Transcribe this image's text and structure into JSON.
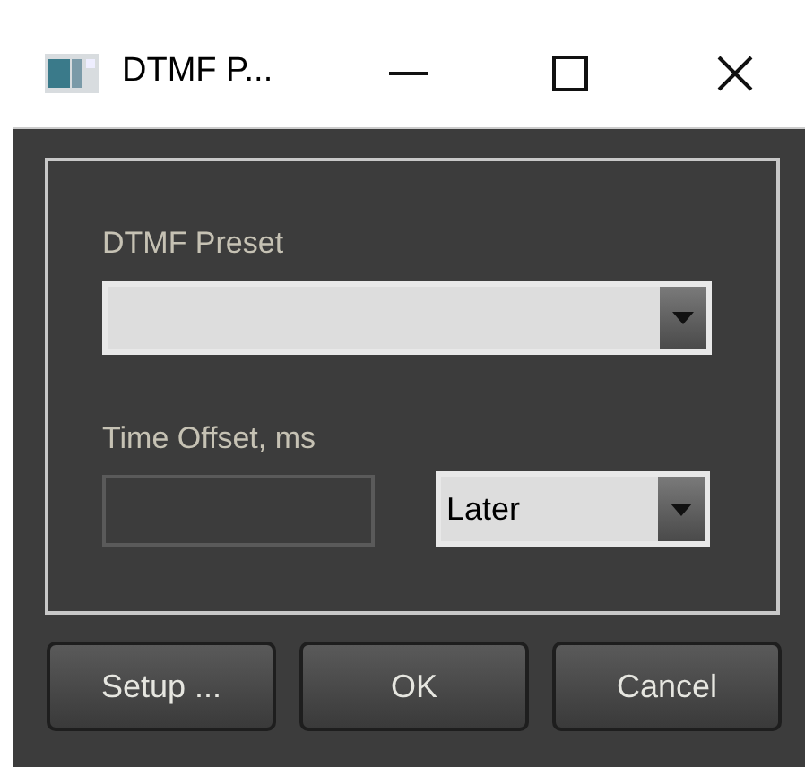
{
  "window": {
    "title": "DTMF P..."
  },
  "preset": {
    "label": "DTMF Preset"
  },
  "offset": {
    "label": "Time Offset, ms",
    "input_disabled": true,
    "direction": "Later"
  },
  "buttons": [
    "Setup ...",
    "OK",
    "Cancel"
  ]
}
